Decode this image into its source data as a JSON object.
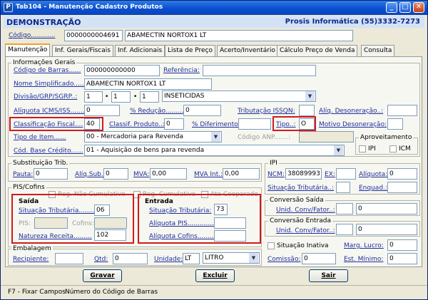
{
  "window": {
    "title": "Tab104 - Manutenção Cadastro Produtos",
    "app_icon": "P"
  },
  "header": {
    "left": "DEMONSTRAÇÃO",
    "right": "Prosis Informática (55)3332-7273"
  },
  "code": {
    "label": "Código............",
    "value": "0000000004691",
    "description": "ABAMECTIN NORTOX1 LT"
  },
  "tabs": [
    "Manutenção",
    "Inf. Gerais/Fiscais",
    "Inf. Adicionais",
    "Lista de Preço",
    "Acerto/Inventário",
    "Cálculo Preço de Venda",
    "Consulta"
  ],
  "info": {
    "title": "Informações Gerais",
    "barcode_label": "Código de Barras......",
    "barcode": "000000000000",
    "ref_label": "Referência:",
    "ref": "",
    "simple_name_label": "Nome Simplificado......",
    "simple_name": "ABAMECTIN NORTOX1 LT",
    "division_label": "Divisão/GRP/SGRP..:",
    "div1": "1",
    "div2": "1",
    "div3": "1",
    "division_name": "INSETICIDAS",
    "icms_label": "Alíquota ICMS/ISS.......",
    "icms": "0",
    "reduction_label": "% Redução.........:",
    "reduction": "0",
    "issqn_label": "Tributação ISSQN:",
    "issqn": "",
    "aliq_deson_label": "Alíq. Desoneração..:",
    "aliq_deson": "",
    "fiscal_class_label": "Classificação Fiscal....",
    "fiscal_class": "40",
    "product_class_label": "Classif. Produto..:",
    "product_class": "0",
    "deferment_label": "% Diferimento:",
    "deferment": "",
    "type_label": "Tipo..:",
    "type": "O",
    "deson_reason_label": "Motivo Desoneração:",
    "deson_reason": "",
    "item_type_label": "Tipo de Item......",
    "item_type": "00 - Mercadoria para Revenda",
    "anp_label": "Código ANP.......:",
    "anp": "",
    "base_credit_label": "Cód. Base Crédito......",
    "base_credit": "01 - Aquisição de bens para revenda",
    "use_title": "Aproveitamento",
    "ipi_check": "IPI",
    "icm_check": "ICM"
  },
  "subst": {
    "title": "Substituição Trib.",
    "pauta_label": "Pauta:",
    "pauta": "0",
    "aliq_sub_label": "Alíq.Sub.:",
    "aliq_sub": "0",
    "mva_label": "MVA:",
    "mva": "0,00",
    "mva_int_label": "MVA Int.:",
    "mva_int": "0,00"
  },
  "ipi": {
    "title": "IPI",
    "ncm_label": "NCM:",
    "ncm": "38089993",
    "ex_label": "EX:",
    "ex": "",
    "aliq_label": "Alíquota:",
    "aliq": "0",
    "sit_label": "Situação Tributária..:",
    "sit": "",
    "enq_label": "Enquad.:",
    "enq": ""
  },
  "pis": {
    "title": "PIS/Cofins",
    "chk1": "Reg. Não Cumulativo",
    "chk2": "Reg. Cumulativo",
    "chk3": "Ato Cooperado",
    "saida": {
      "title": "Saída",
      "sit_label": "Situação Tributária........",
      "sit": "06",
      "pis_label": "PIS:",
      "pis": "",
      "cofins_label": "Cofins:",
      "cofins": "",
      "nat_label": "Natureza Receita.........",
      "nat": "102"
    },
    "entrada": {
      "title": "Entrada",
      "sit_label": "Situação Tributária:",
      "sit": "73",
      "aliq_pis_label": "Alíquota PIS.............",
      "aliq_pis": "",
      "aliq_cofins_label": "Alíquota Cofins.........",
      "aliq_cofins": ""
    }
  },
  "conv_saida": {
    "title": "Conversão Saída",
    "label": "Unid. Conv/Fator..:",
    "unit": "",
    "factor": "0"
  },
  "conv_entrada": {
    "title": "Conversão Entrada",
    "label": "Unid. Conv/Fator..:",
    "unit": "",
    "factor": "0"
  },
  "packaging": {
    "title": "Embalagem",
    "recipient_label": "Recipiente:",
    "recipient": "",
    "qty_label": "Qtd:",
    "qty": "0",
    "unit_label": "Unidade:",
    "unit": "LT",
    "unit_name": "LITRO"
  },
  "inactive_label": "Situação Inativa",
  "profit_label": "Marg. Lucro:",
  "profit": "0",
  "commission_label": "Comissão:",
  "commission": "0",
  "min_stock_label": "Est. Mínimo:",
  "min_stock": "0",
  "buttons": {
    "save": "Gravar",
    "delete": "Excluir",
    "exit": "Sair"
  },
  "status": {
    "key_hint": "F7 - Fixar Campos",
    "field_hint": "Número do Código de Barras"
  },
  "colors": {
    "titlebar": "#0a4fcf",
    "header_text": "#0a2a8c",
    "highlight": "#d11a1a"
  }
}
